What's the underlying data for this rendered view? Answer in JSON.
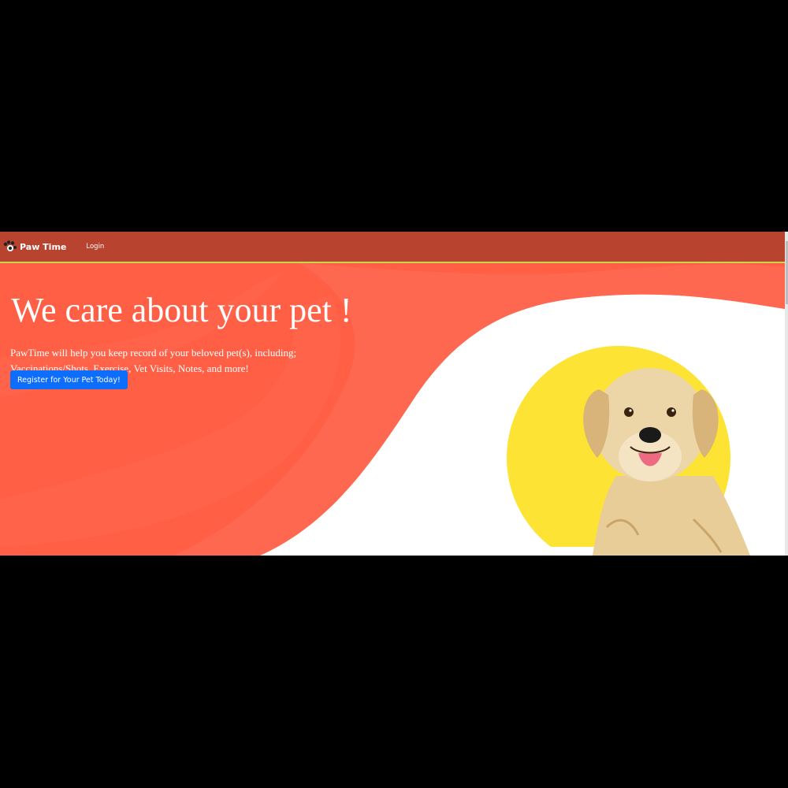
{
  "navbar": {
    "brand_name": "Paw Time",
    "login_label": "Login",
    "brand_icon": "paw-logo-icon"
  },
  "hero": {
    "title": "We care about your pet !",
    "description": "PawTime will help you keep record of your beloved pet(s), including; Vaccinations/Shots, Exercise, Vet Visits, Notes, and more!",
    "cta_label": "Register for Your Pet Today!",
    "image": "golden-retriever-photo"
  },
  "colors": {
    "navbar_bg": "#b84430",
    "navbar_border": "#c8d64a",
    "hero_wave": "#ff5f45",
    "cta_bg": "#0d6efd",
    "sun_circle": "#fde333"
  }
}
